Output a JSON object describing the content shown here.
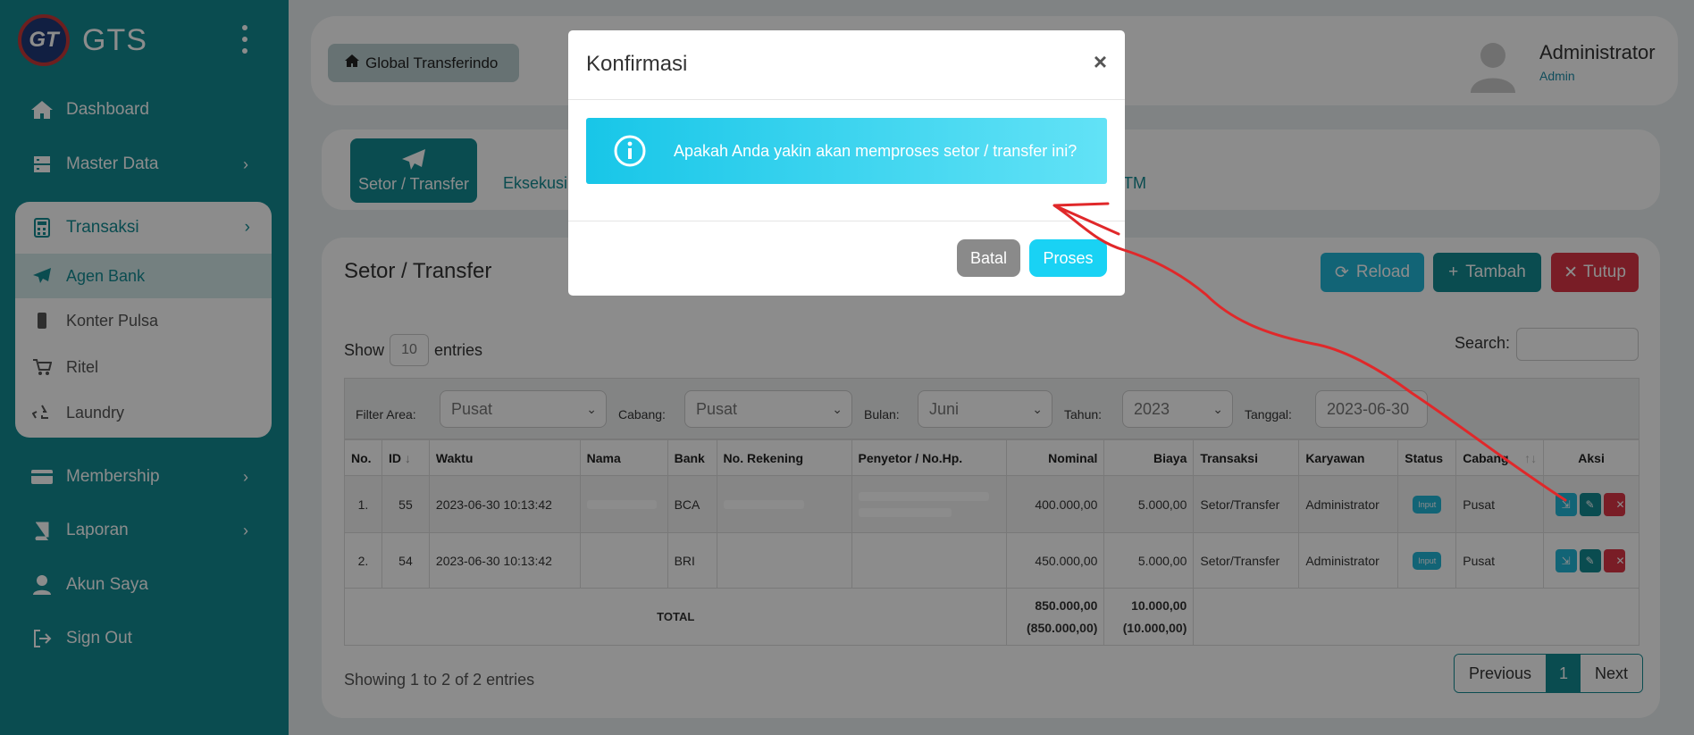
{
  "brand": {
    "logo_text": "GT",
    "name": "GTS"
  },
  "sidebar": {
    "items": [
      {
        "label": "Dashboard",
        "icon": "home-icon"
      },
      {
        "label": "Master Data",
        "icon": "server-icon"
      },
      {
        "label": "Transaksi",
        "icon": "calculator-icon"
      },
      {
        "label": "Agen Bank",
        "icon": "paper-plane-icon"
      },
      {
        "label": "Konter Pulsa",
        "icon": "mobile-icon"
      },
      {
        "label": "Ritel",
        "icon": "cart-icon"
      },
      {
        "label": "Laundry",
        "icon": "recycle-icon"
      },
      {
        "label": "Membership",
        "icon": "credit-card-icon"
      },
      {
        "label": "Laporan",
        "icon": "book-icon"
      },
      {
        "label": "Akun Saya",
        "icon": "user-icon"
      },
      {
        "label": "Sign Out",
        "icon": "sign-out-icon"
      }
    ]
  },
  "header": {
    "home_chip": "Global Transferindo",
    "user_name": "Administrator",
    "user_role": "Admin"
  },
  "tabs": {
    "active": "Setor / Transfer",
    "second": "Eksekusi",
    "partial": "TM"
  },
  "page": {
    "title": "Setor / Transfer",
    "reload": "Reload",
    "tambah": "Tambah",
    "tutup": "Tutup",
    "show": "Show",
    "entries_value": "10",
    "entries": "entries",
    "search": "Search:"
  },
  "filters": {
    "area_label": "Filter Area:",
    "area_value": "Pusat",
    "cabang_label": "Cabang:",
    "cabang_value": "Pusat",
    "bulan_label": "Bulan:",
    "bulan_value": "Juni",
    "tahun_label": "Tahun:",
    "tahun_value": "2023",
    "tanggal_label": "Tanggal:",
    "tanggal_value": "2023-06-30"
  },
  "table": {
    "headers": [
      "No.",
      "ID",
      "Waktu",
      "Nama",
      "Bank",
      "No. Rekening",
      "Penyetor / No.Hp.",
      "Nominal",
      "Biaya",
      "Transaksi",
      "Karyawan",
      "Status",
      "Cabang",
      "Aksi"
    ],
    "rows": [
      {
        "no": "1.",
        "id": "55",
        "waktu": "2023-06-30 10:13:42",
        "bank": "BCA",
        "nominal": "400.000,00",
        "biaya": "5.000,00",
        "transaksi": "Setor/Transfer",
        "karyawan": "Administrator",
        "status": "Input",
        "cabang": "Pusat"
      },
      {
        "no": "2.",
        "id": "54",
        "waktu": "2023-06-30 10:13:42",
        "bank": "BRI",
        "nominal": "450.000,00",
        "biaya": "5.000,00",
        "transaksi": "Setor/Transfer",
        "karyawan": "Administrator",
        "status": "Input",
        "cabang": "Pusat"
      }
    ],
    "total_label": "TOTAL",
    "total_nominal": "850.000,00",
    "total_nominal_paren": "(850.000,00)",
    "total_biaya": "10.000,00",
    "total_biaya_paren": "(10.000,00)"
  },
  "footer": {
    "info": "Showing 1 to 2 of 2 entries",
    "previous": "Previous",
    "page": "1",
    "next": "Next"
  },
  "modal": {
    "title": "Konfirmasi",
    "close": "×",
    "message": "Apakah Anda yakin akan memproses setor / transfer ini?",
    "batal": "Batal",
    "proses": "Proses"
  },
  "colors": {
    "primary": "#138a92",
    "info": "#19d2f4",
    "danger": "#dc3545",
    "annotation": "#e0282a"
  }
}
